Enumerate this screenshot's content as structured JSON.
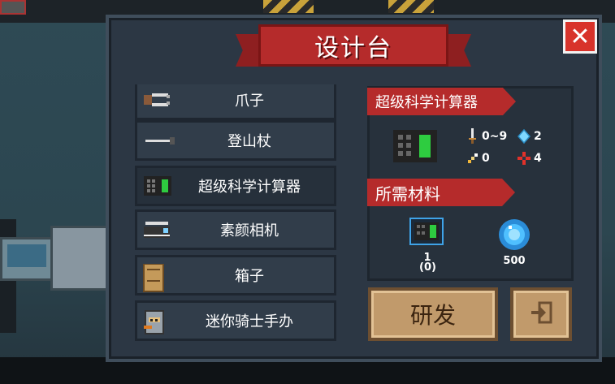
{
  "title": "设计台",
  "close_label": "✕",
  "items": [
    {
      "label": "爪子",
      "icon": "claw-icon"
    },
    {
      "label": "登山杖",
      "icon": "walking-stick-icon"
    },
    {
      "label": "超级科学计算器",
      "icon": "calculator-icon"
    },
    {
      "label": "素颜相机",
      "icon": "camera-icon"
    },
    {
      "label": "箱子",
      "icon": "box-icon"
    },
    {
      "label": "迷你骑士手办",
      "icon": "knight-figure-icon"
    }
  ],
  "selected_index": 2,
  "detail": {
    "name": "超级科学计算器",
    "stats": {
      "damage": "0~9",
      "energy": "2",
      "crit": "0",
      "accuracy": "4"
    },
    "materials_title": "所需材料",
    "materials": [
      {
        "icon": "calculator-blueprint-icon",
        "count": "1\n(0)"
      },
      {
        "icon": "blue-gem-icon",
        "count": "500"
      }
    ]
  },
  "buttons": {
    "research": "研发",
    "exit_icon": "exit-icon"
  },
  "colors": {
    "ribbon": "#b52b2b",
    "panel": "#2c3744",
    "button": "#c19a6b",
    "close": "#d8332b"
  }
}
